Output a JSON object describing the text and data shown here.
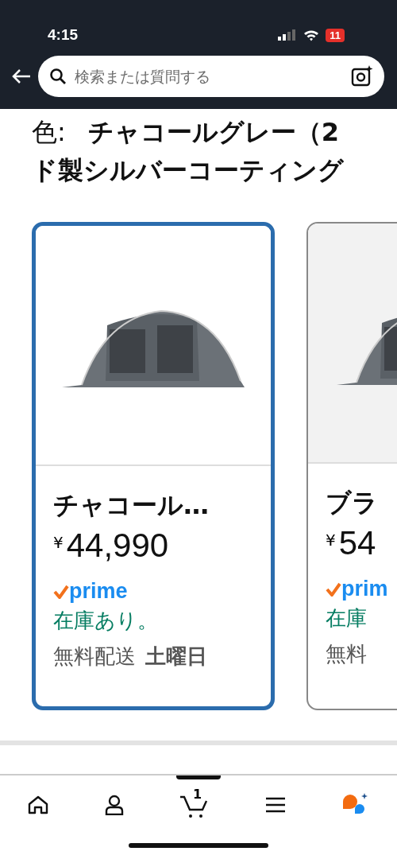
{
  "status_bar": {
    "time": "4:15",
    "battery": "11"
  },
  "search": {
    "placeholder": "検索または質問する"
  },
  "color_heading": {
    "label": "色:",
    "lines": [
      "チャコールグレー（2",
      "ド製シルバーコーティング"
    ]
  },
  "options": [
    {
      "title": "チャコール…",
      "currency": "¥",
      "price": "44,990",
      "prime": "prime",
      "stock": "在庫あり。",
      "shipping": "無料配送",
      "day": "土曜日",
      "selected": true
    },
    {
      "title": "ブラ",
      "currency": "¥",
      "price": "54",
      "prime": "prim",
      "stock": "在庫",
      "shipping": "無料",
      "selected": false
    }
  ],
  "nav": [
    {
      "kind": "home"
    },
    {
      "kind": "account"
    },
    {
      "kind": "cart",
      "badge": "1"
    },
    {
      "kind": "menu"
    },
    {
      "kind": "assistant"
    }
  ]
}
